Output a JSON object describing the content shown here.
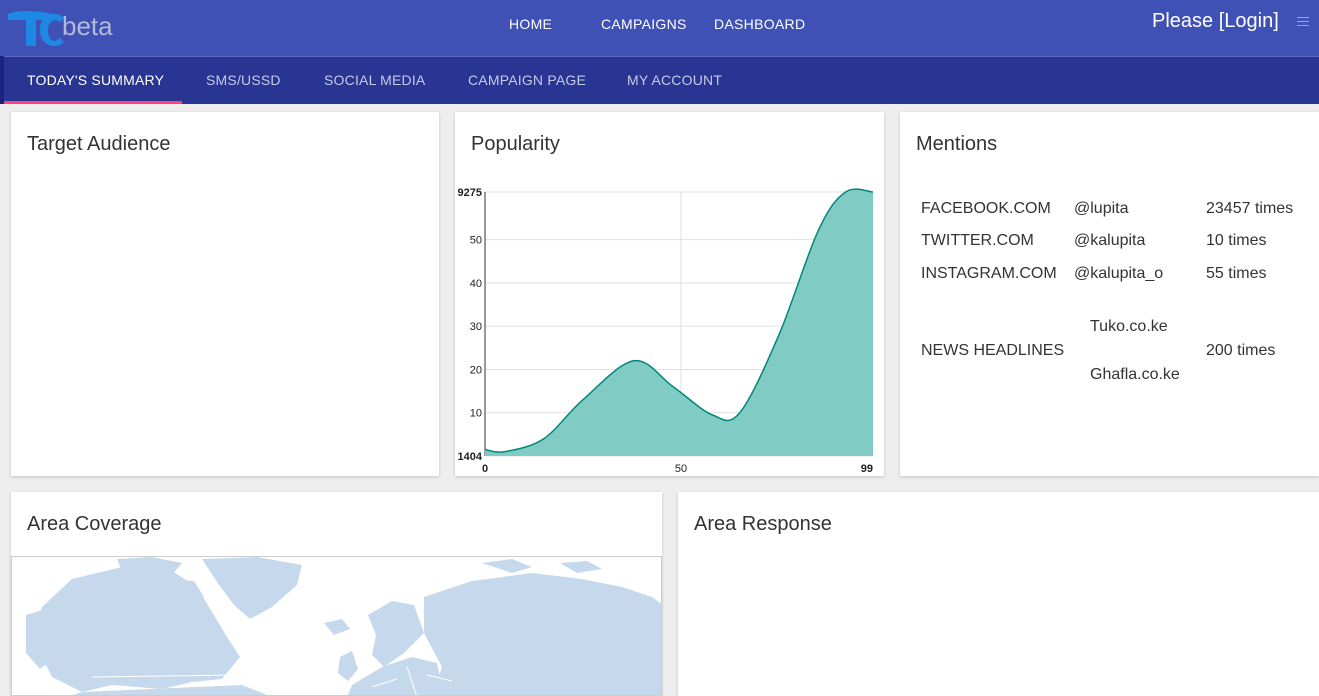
{
  "brand": {
    "suffix": "beta"
  },
  "topnav": {
    "home": "HOME",
    "campaigns": "CAMPAIGNS",
    "dashboard": "DASHBOARD",
    "login": "Please [Login]"
  },
  "tabs": [
    {
      "label": "TODAY'S SUMMARY",
      "active": true
    },
    {
      "label": "SMS/USSD"
    },
    {
      "label": "SOCIAL MEDIA"
    },
    {
      "label": "CAMPAIGN PAGE"
    },
    {
      "label": "MY ACCOUNT"
    }
  ],
  "cards": {
    "target_audience": {
      "title": "Target Audience"
    },
    "popularity": {
      "title": "Popularity"
    },
    "mentions": {
      "title": "Mentions"
    },
    "area_coverage": {
      "title": "Area Coverage"
    },
    "area_response": {
      "title": "Area Response"
    }
  },
  "mentions": {
    "rows": [
      {
        "site": "FACEBOOK.COM",
        "handle": "@lupita",
        "count": "23457 times"
      },
      {
        "site": "TWITTER.COM",
        "handle": "@kalupita",
        "count": "10 times"
      },
      {
        "site": "INSTAGRAM.COM",
        "handle": "@kalupita_o",
        "count": "55 times"
      }
    ],
    "news": {
      "label": "NEWS HEADLINES",
      "sources": [
        "Tuko.co.ke",
        "Ghafla.co.ke"
      ],
      "count": "200 times"
    }
  },
  "chart_data": {
    "type": "area",
    "title": "",
    "x": [
      0,
      5,
      15,
      25,
      38,
      48,
      58,
      65,
      75,
      85,
      92,
      99
    ],
    "y": [
      1.5,
      1.0,
      4.0,
      13.0,
      22.0,
      16.0,
      9.5,
      10.0,
      28.0,
      52.0,
      61.0,
      61.0
    ],
    "xticks": [
      "0",
      "50",
      "99"
    ],
    "yticks": [
      "1404",
      "10",
      "20",
      "30",
      "40",
      "50",
      "9275"
    ],
    "xlim": [
      0,
      99
    ],
    "ylim": [
      0,
      61
    ],
    "grid": true,
    "colors": {
      "fill": "#80cbc4",
      "line": "#00897b"
    }
  }
}
